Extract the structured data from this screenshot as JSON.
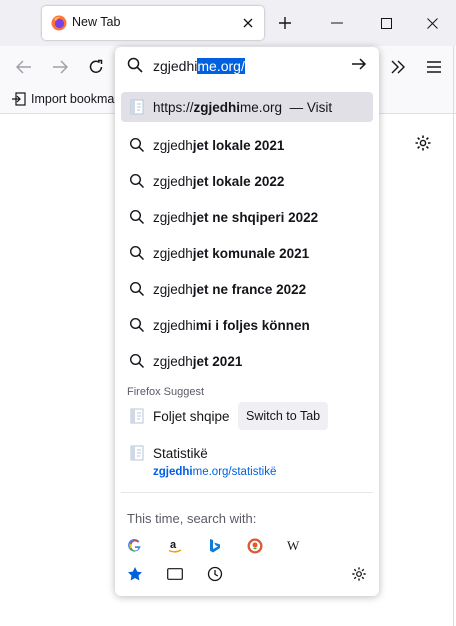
{
  "tab": {
    "title": "New Tab"
  },
  "bookmarks": {
    "import_label": "Import bookma"
  },
  "urlbar": {
    "typed": "zgjedhi",
    "autofill_selected": "me.org/"
  },
  "results": [
    {
      "kind": "url",
      "prefix": "https://",
      "bold": "zgjedhi",
      "rest": "me.org",
      "action": "— Visit"
    },
    {
      "kind": "search",
      "typed": "zgjedh",
      "bold": "jet lokale 2021"
    },
    {
      "kind": "search",
      "typed": "zgjedh",
      "bold": "jet lokale 2022"
    },
    {
      "kind": "search",
      "typed": "zgjedh",
      "bold": "jet ne shqiperi 2022"
    },
    {
      "kind": "search",
      "typed": "zgjedh",
      "bold": "jet komunale 2021"
    },
    {
      "kind": "search",
      "typed": "zgjedh",
      "bold": "jet ne france 2022"
    },
    {
      "kind": "search",
      "typed": "zgjedhi",
      "bold": "mi i foljes können"
    },
    {
      "kind": "search",
      "typed": "zgjedh",
      "bold": "jet 2021"
    }
  ],
  "suggest": {
    "label": "Firefox Suggest",
    "tab_result": {
      "title": "Foljet shqipe",
      "action": "Switch to Tab"
    },
    "history_result": {
      "title": "Statistikë",
      "url_bold": "zgjedhi",
      "url_rest": "me.org/statistikë"
    }
  },
  "one_off": {
    "label": "This time, search with:",
    "engines": [
      "google-icon",
      "amazon-icon",
      "bing-icon",
      "duckduckgo-icon",
      "wikipedia-icon"
    ],
    "modes": [
      "bookmarks-star-icon",
      "tabs-icon",
      "history-clock-icon"
    ]
  },
  "colors": {
    "accent": "#0060df",
    "selected_row": "#e0e0e6",
    "chrome": "#f0f0f4"
  }
}
